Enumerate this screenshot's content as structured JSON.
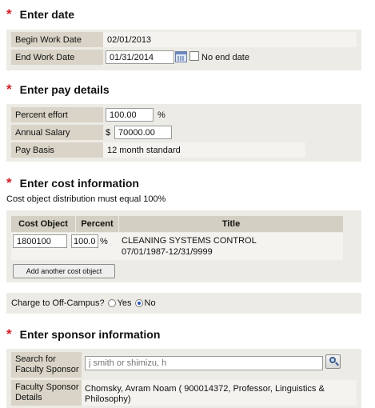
{
  "date_section": {
    "title": "Enter date",
    "begin_label": "Begin Work Date",
    "begin_value": "02/01/2013",
    "end_label": "End Work Date",
    "end_value": "01/31/2014",
    "no_end_date_label": "No end date",
    "no_end_date_checked": false
  },
  "pay_section": {
    "title": "Enter pay details",
    "percent_label": "Percent effort",
    "percent_value": "100.00",
    "percent_unit": "%",
    "salary_label": "Annual Salary",
    "salary_prefix": "$",
    "salary_value": "70000.00",
    "basis_label": "Pay Basis",
    "basis_value": "12 month standard"
  },
  "cost_section": {
    "title": "Enter cost information",
    "note": "Cost object distribution must equal 100%",
    "headers": {
      "cost_object": "Cost Object",
      "percent": "Percent",
      "title": "Title"
    },
    "rows": [
      {
        "cost_object": "1800100",
        "percent": "100.0",
        "percent_unit": "%",
        "title_line1": "CLEANING SYSTEMS CONTROL",
        "title_line2": "07/01/1987-12/31/9999"
      }
    ],
    "add_button": "Add another cost object"
  },
  "offcampus": {
    "label": "Charge to Off-Campus?",
    "yes_label": "Yes",
    "no_label": "No",
    "selected": "No"
  },
  "sponsor_section": {
    "title": "Enter sponsor information",
    "search_label_line1": "Search for",
    "search_label_line2": "Faculty Sponsor",
    "search_placeholder": "j smith or shimizu, h",
    "details_label_line1": "Faculty Sponsor",
    "details_label_line2": "Details",
    "details_line1": "Chomsky, Avram Noam ( 900014372, Professor, Linguistics &",
    "details_line2": "Philosophy)"
  },
  "colors": {
    "accent_star": "#d0202a",
    "label_bg": "#d9d4c7",
    "panel_bg": "#ecebe6",
    "radio_selected": "#2a56b8"
  },
  "icons": [
    "calendar-icon",
    "search-icon"
  ]
}
